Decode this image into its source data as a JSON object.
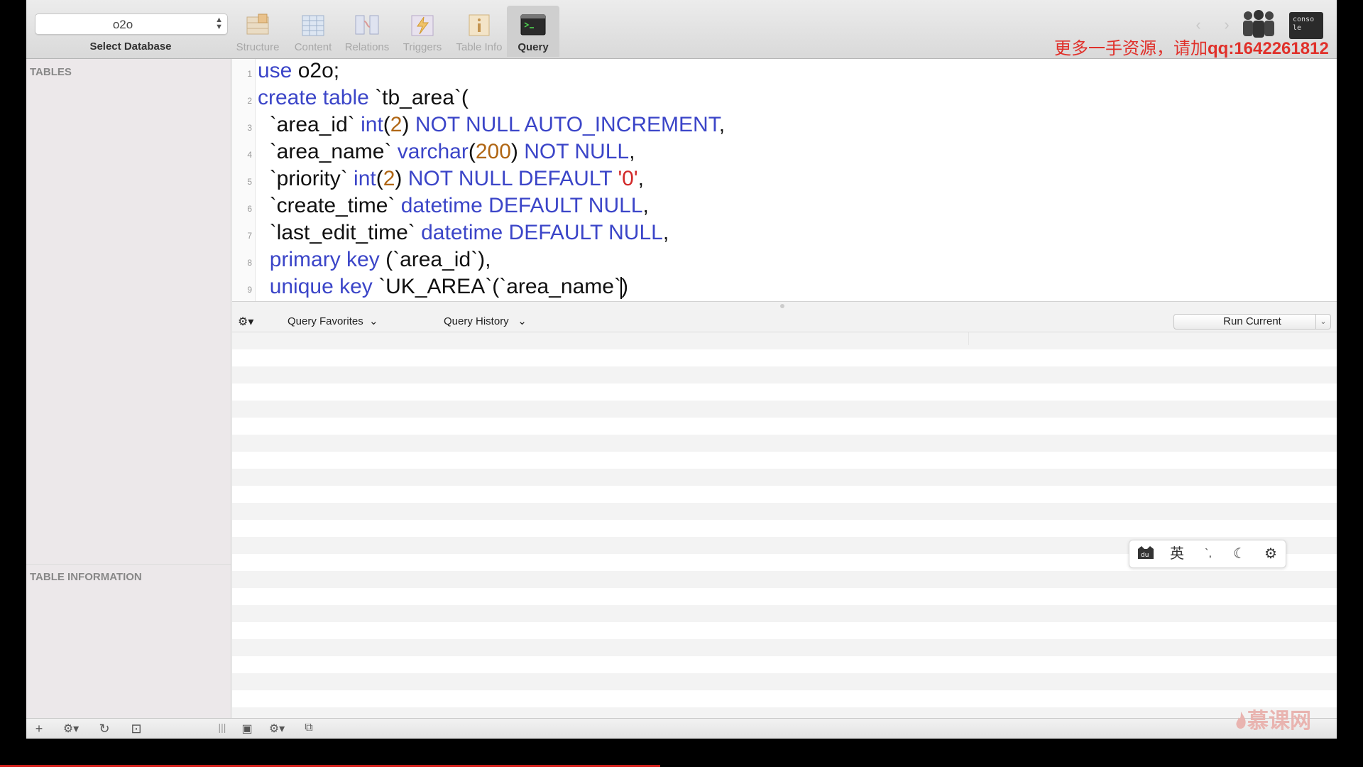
{
  "toolbar": {
    "database": "o2o",
    "select_database_label": "Select Database",
    "buttons": [
      {
        "label": "Structure",
        "icon": "structure-icon"
      },
      {
        "label": "Content",
        "icon": "content-icon"
      },
      {
        "label": "Relations",
        "icon": "relations-icon"
      },
      {
        "label": "Triggers",
        "icon": "triggers-icon"
      },
      {
        "label": "Table Info",
        "icon": "table-info-icon"
      },
      {
        "label": "Query",
        "icon": "query-terminal-icon",
        "active": true
      }
    ]
  },
  "watermark": {
    "text": "更多一手资源，请加",
    "qq": "qq:1642261812"
  },
  "sidebar": {
    "tables_header": "TABLES",
    "table_info_header": "TABLE INFORMATION"
  },
  "editor": {
    "line_numbers": [
      "1",
      "2",
      "3",
      "4",
      "5",
      "6",
      "7",
      "8",
      "9"
    ],
    "lines": [
      "use o2o;",
      "create table `tb_area`(",
      "  `area_id` int(2) NOT NULL AUTO_INCREMENT,",
      "  `area_name` varchar(200) NOT NULL,",
      "  `priority` int(2) NOT NULL DEFAULT '0',",
      "  `create_time` datetime DEFAULT NULL,",
      "  `last_edit_time` datetime DEFAULT NULL,",
      "  primary key (`area_id`),",
      "  unique key `UK_AREA`(`area_name`)"
    ]
  },
  "querybar": {
    "favorites": "Query Favorites",
    "history": "Query History",
    "run": "Run Current"
  },
  "ime": {
    "lang": "英",
    "punct": "`,"
  },
  "logo": {
    "text": "慕课网"
  },
  "colors": {
    "keyword": "#3b45c8",
    "number": "#b06614",
    "string": "#d22a2a",
    "watermark": "#e0302a"
  }
}
